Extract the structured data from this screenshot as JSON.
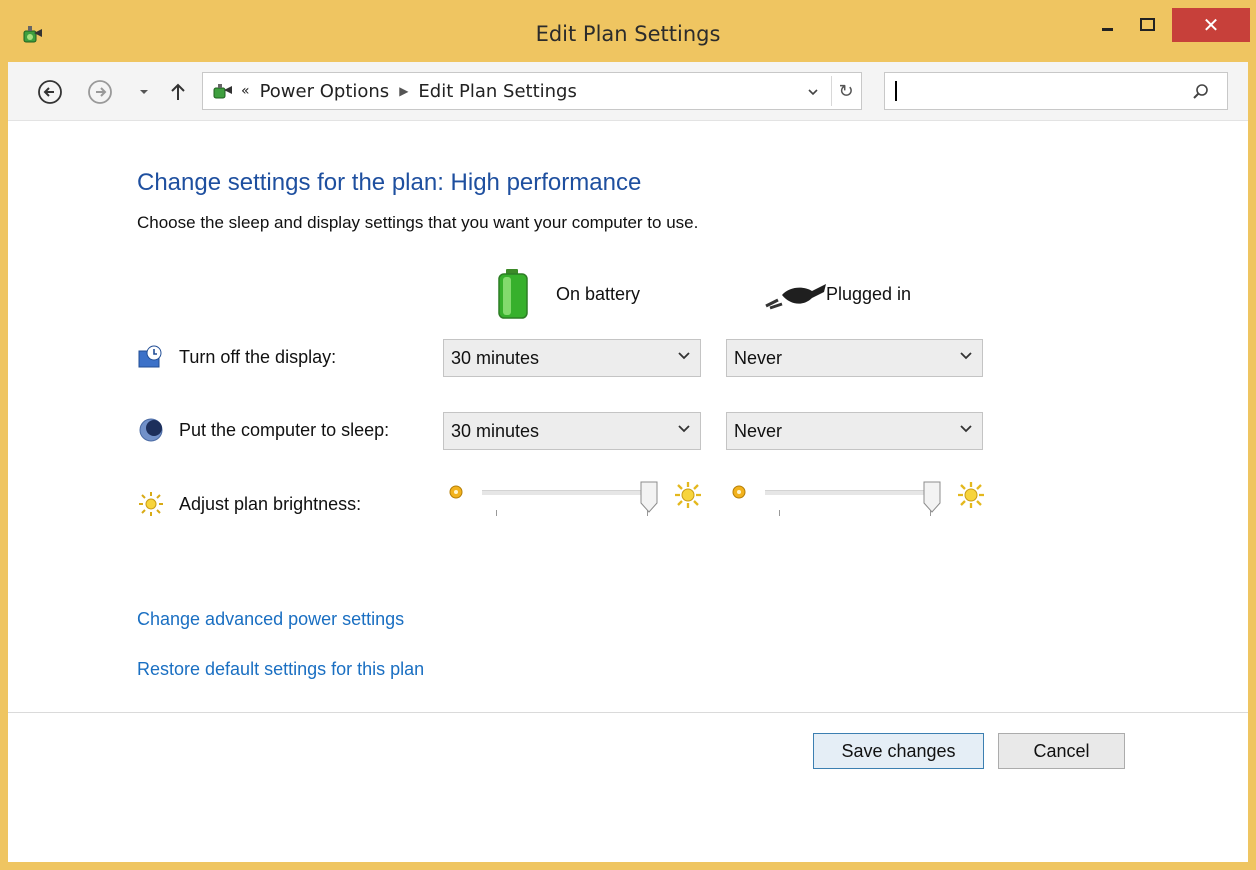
{
  "window": {
    "title": "Edit Plan Settings",
    "controls": {
      "minimize": "minimize-icon",
      "maximize": "maximize-icon",
      "close": "close-icon"
    }
  },
  "navigation": {
    "address_prefix": "«",
    "breadcrumbs": [
      "Power Options",
      "Edit Plan Settings"
    ],
    "search_value": ""
  },
  "main": {
    "heading": "Change settings for the plan: High performance",
    "subheading": "Choose the sleep and display settings that you want your computer to use.",
    "columns": [
      "On battery",
      "Plugged in"
    ],
    "settings": [
      {
        "label": "Turn off the display:",
        "on_battery": "30 minutes",
        "plugged_in": "Never",
        "icon": "display-clock-icon"
      },
      {
        "label": "Put the computer to sleep:",
        "on_battery": "30 minutes",
        "plugged_in": "Never",
        "icon": "moon-icon"
      },
      {
        "label": "Adjust plan brightness:",
        "icon": "brightness-sun-icon",
        "brightness": {
          "on_battery": 1.0,
          "plugged_in": 1.0
        }
      }
    ],
    "links": [
      "Change advanced power settings",
      "Restore default settings for this plan"
    ]
  },
  "footer": {
    "save_label": "Save changes",
    "cancel_label": "Cancel"
  },
  "colors": {
    "title_bar": "#efc561",
    "close_button": "#c7403a",
    "heading": "#1e4f9f",
    "link": "#1a6fc2",
    "primary_border": "#3c7fb1"
  }
}
